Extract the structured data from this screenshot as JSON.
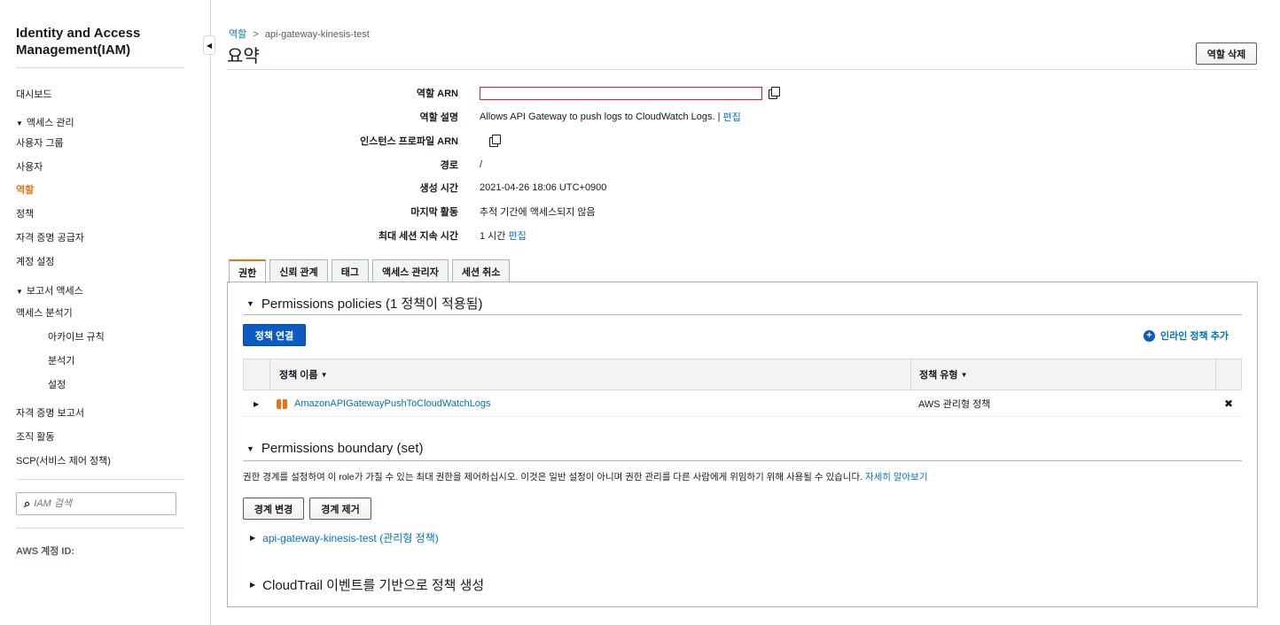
{
  "sidebar": {
    "title_line1": "Identity and Access",
    "title_line2": "Management(IAM)",
    "items": [
      {
        "label": "대시보드"
      },
      {
        "label": "액세스 관리"
      },
      {
        "label": "사용자 그룹"
      },
      {
        "label": "사용자"
      },
      {
        "label": "역할"
      },
      {
        "label": "정책"
      },
      {
        "label": "자격 증명 공급자"
      },
      {
        "label": "계정 설정"
      },
      {
        "label": "보고서 액세스"
      },
      {
        "label": "액세스 분석기"
      },
      {
        "label": "아카이브 규칙"
      },
      {
        "label": "분석기"
      },
      {
        "label": "설정"
      },
      {
        "label": "자격 증명 보고서"
      },
      {
        "label": "조직 활동"
      },
      {
        "label": "SCP(서비스 제어 정책)"
      }
    ],
    "search_placeholder": "IAM 검색",
    "account_label": "AWS 계정 ID:"
  },
  "breadcrumb": {
    "root": "역할",
    "sep": ">",
    "current": "api-gateway-kinesis-test"
  },
  "page_title": "요약",
  "delete_button": "역할 삭제",
  "summary": {
    "arn_label": "역할 ARN",
    "desc_label": "역할 설명",
    "desc_value": "Allows API Gateway to push logs to CloudWatch Logs. |",
    "desc_edit": "편집",
    "instance_label": "인스턴스 프로파일 ARN",
    "path_label": "경로",
    "path_value": "/",
    "created_label": "생성 시간",
    "created_value": "2021-04-26 18:06 UTC+0900",
    "last_activity_label": "마지막 활동",
    "last_activity_value": "추적 기간에 액세스되지 않음",
    "max_session_label": "최대 세션 지속 시간",
    "max_session_value": "1 시간",
    "max_session_edit": "편집"
  },
  "tabs": [
    "권한",
    "신뢰 관계",
    "태그",
    "액세스 관리자",
    "세션 취소"
  ],
  "permissions": {
    "heading": "Permissions policies (1 정책이 적용됨)",
    "attach_button": "정책 연결",
    "inline_add": "인라인 정책 추가",
    "col_name": "정책 이름",
    "col_type": "정책 유형",
    "rows": [
      {
        "name": "AmazonAPIGatewayPushToCloudWatchLogs",
        "type": "AWS 관리형 정책",
        "remove": "✖"
      }
    ]
  },
  "boundary": {
    "heading": "Permissions boundary (set)",
    "description": "권한 경계를 설정하여 이 role가 가질 수 있는 최대 권한을 제어하십시오. 이것은 일반 설정이 아니며 권한 관리를 다른 사람에게 위임하기 위해 사용될 수 있습니다.",
    "learn_more": "자세히 알아보기",
    "change_button": "경계 변경",
    "remove_button": "경계 제거",
    "policy_link": "api-gateway-kinesis-test (관리형 정책)"
  },
  "cloudtrail": {
    "heading": "CloudTrail 이벤트를 기반으로 정책 생성"
  },
  "colors": {
    "accent": "#ec7211",
    "link": "#0073bb",
    "primary": "#0a5bc4"
  }
}
